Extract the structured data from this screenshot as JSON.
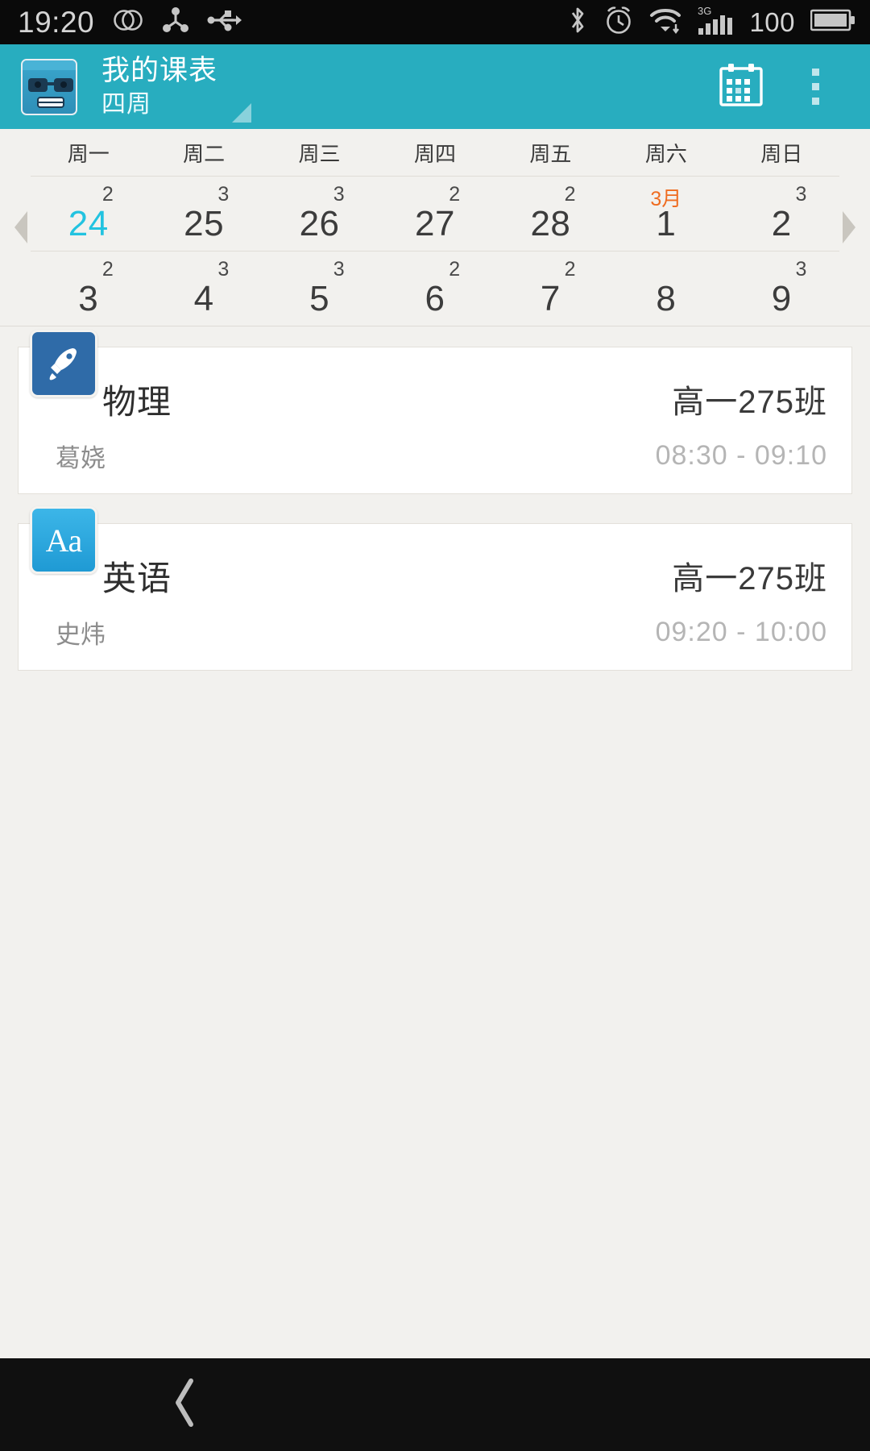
{
  "status_bar": {
    "time": "19:20",
    "battery_percent": "100",
    "icons": [
      "dual-sim-icon",
      "share-icon",
      "usb-icon",
      "bluetooth-icon",
      "alarm-icon",
      "wifi-icon",
      "signal-3g-icon",
      "battery-icon"
    ],
    "network_label": "3G"
  },
  "app_bar": {
    "logo": "nerd-face-logo",
    "title": "我的课表",
    "subtitle": "四周",
    "calendar_icon": "calendar-icon",
    "overflow_icon": "overflow-menu-icon"
  },
  "week_strip": {
    "weekdays": [
      "周一",
      "周二",
      "周三",
      "周四",
      "周五",
      "周六",
      "周日"
    ],
    "prev_arrow": "chevron-left-icon",
    "next_arrow": "chevron-right-icon",
    "rows": [
      {
        "days": [
          {
            "num": "24",
            "badge": "2",
            "selected": true,
            "month_label": ""
          },
          {
            "num": "25",
            "badge": "3",
            "selected": false,
            "month_label": ""
          },
          {
            "num": "26",
            "badge": "3",
            "selected": false,
            "month_label": ""
          },
          {
            "num": "27",
            "badge": "2",
            "selected": false,
            "month_label": ""
          },
          {
            "num": "28",
            "badge": "2",
            "selected": false,
            "month_label": ""
          },
          {
            "num": "1",
            "badge": "",
            "selected": false,
            "month_label": "3月"
          },
          {
            "num": "2",
            "badge": "3",
            "selected": false,
            "month_label": ""
          }
        ]
      },
      {
        "days": [
          {
            "num": "3",
            "badge": "2",
            "selected": false,
            "month_label": ""
          },
          {
            "num": "4",
            "badge": "3",
            "selected": false,
            "month_label": ""
          },
          {
            "num": "5",
            "badge": "3",
            "selected": false,
            "month_label": ""
          },
          {
            "num": "6",
            "badge": "2",
            "selected": false,
            "month_label": ""
          },
          {
            "num": "7",
            "badge": "2",
            "selected": false,
            "month_label": ""
          },
          {
            "num": "8",
            "badge": "",
            "selected": false,
            "month_label": ""
          },
          {
            "num": "9",
            "badge": "3",
            "selected": false,
            "month_label": ""
          }
        ]
      }
    ]
  },
  "courses": [
    {
      "icon": "rocket-icon",
      "icon_color": "#2f6ba8",
      "icon_glyph": "rocket",
      "name": "物理",
      "class": "高一275班",
      "teacher": "葛娆",
      "time": "08:30 - 09:10"
    },
    {
      "icon": "letters-aa-icon",
      "icon_color": "#2ba6de",
      "icon_glyph": "Aa",
      "name": "英语",
      "class": "高一275班",
      "teacher": "史炜",
      "time": "09:20 - 10:00"
    }
  ],
  "nav_bar": {
    "back_icon": "back-chevron-icon"
  },
  "colors": {
    "accent": "#28adbf",
    "selected_date": "#22c3e0",
    "month_marker": "#ef6c20",
    "page_bg": "#f2f1ee",
    "card_bg": "#ffffff"
  }
}
